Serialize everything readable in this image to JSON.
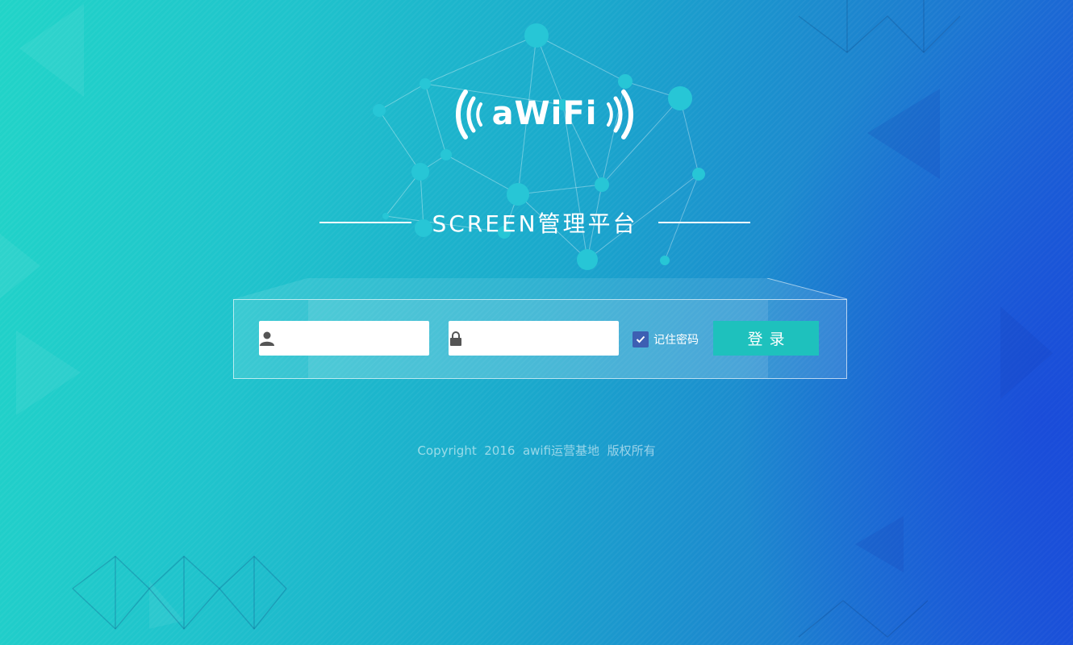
{
  "background": {
    "colors": [
      "#21d4c8",
      "#1aa9cc",
      "#1a56d8"
    ]
  },
  "brand": {
    "logo_text": "aWiFi",
    "subtitle": "SCREEN管理平台"
  },
  "login_form": {
    "username": {
      "value": "",
      "placeholder": "",
      "icon": "user-icon"
    },
    "password": {
      "value": "",
      "placeholder": "",
      "icon": "lock-icon"
    },
    "remember": {
      "label": "记住密码",
      "checked": true,
      "accent": "#3d5fb3"
    },
    "submit_label": "登录",
    "submit_color": "#1ec1bd"
  },
  "footer": {
    "copyright": "Copyright  2016  awifi运营基地  版权所有"
  }
}
